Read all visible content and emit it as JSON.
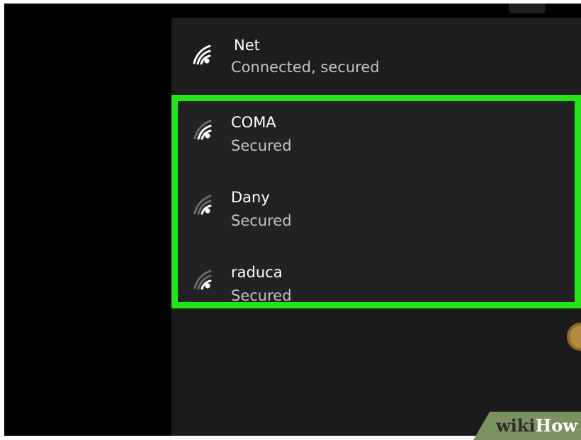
{
  "connected_network": {
    "ssid": "Net",
    "status": "Connected, secured",
    "icon": "wifi-signal-full-icon"
  },
  "available_networks": [
    {
      "ssid": "COMA",
      "status": "Secured",
      "icon": "wifi-signal-partial-icon"
    },
    {
      "ssid": "Dany",
      "status": "Secured",
      "icon": "wifi-signal-partial-icon"
    },
    {
      "ssid": "raduca",
      "status": "Secured",
      "icon": "wifi-signal-partial-icon"
    }
  ],
  "highlight_color": "#22e61a",
  "watermark": {
    "part1": "wiki",
    "part2": "How"
  }
}
